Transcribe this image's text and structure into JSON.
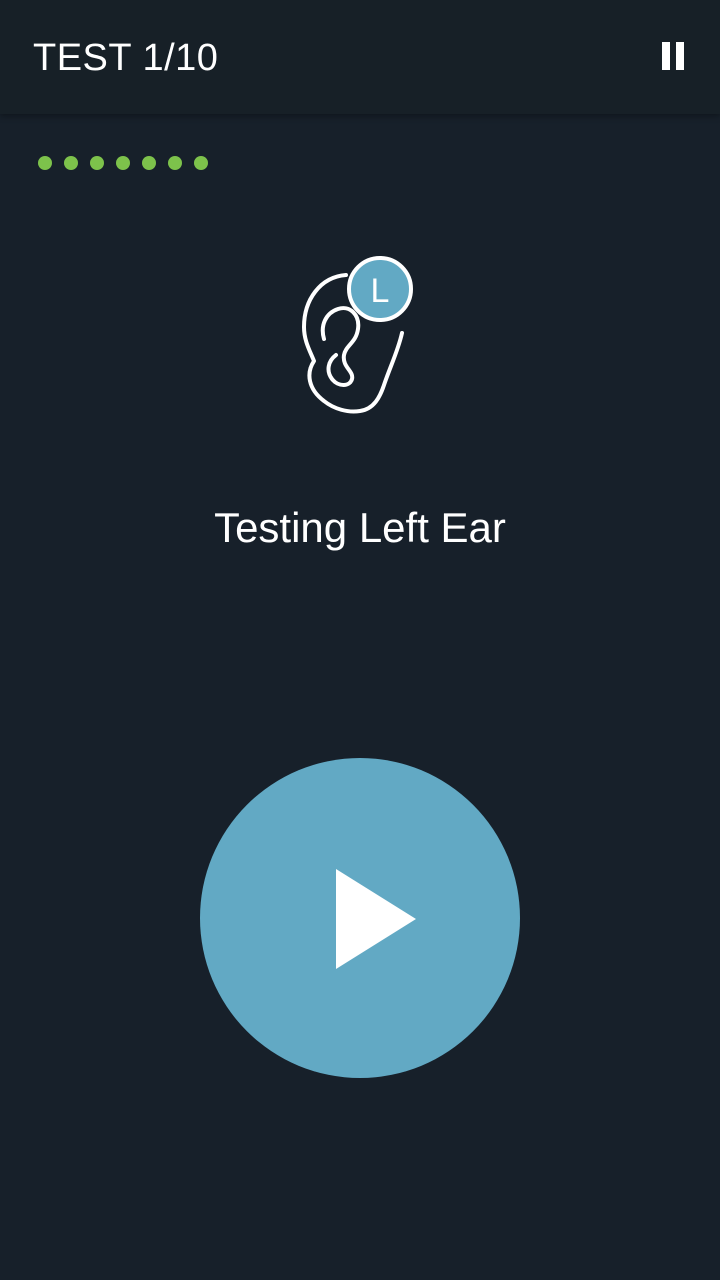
{
  "header": {
    "title": "TEST 1/10",
    "pause_icon": "pause-icon"
  },
  "progress": {
    "completed_dots": 7,
    "color": "#7dc24b"
  },
  "ear": {
    "icon": "ear-icon",
    "badge_letter": "L",
    "badge_color": "#62a9c4"
  },
  "main": {
    "subtitle": "Testing Left Ear"
  },
  "play": {
    "icon": "play-icon",
    "color": "#62a9c4"
  }
}
